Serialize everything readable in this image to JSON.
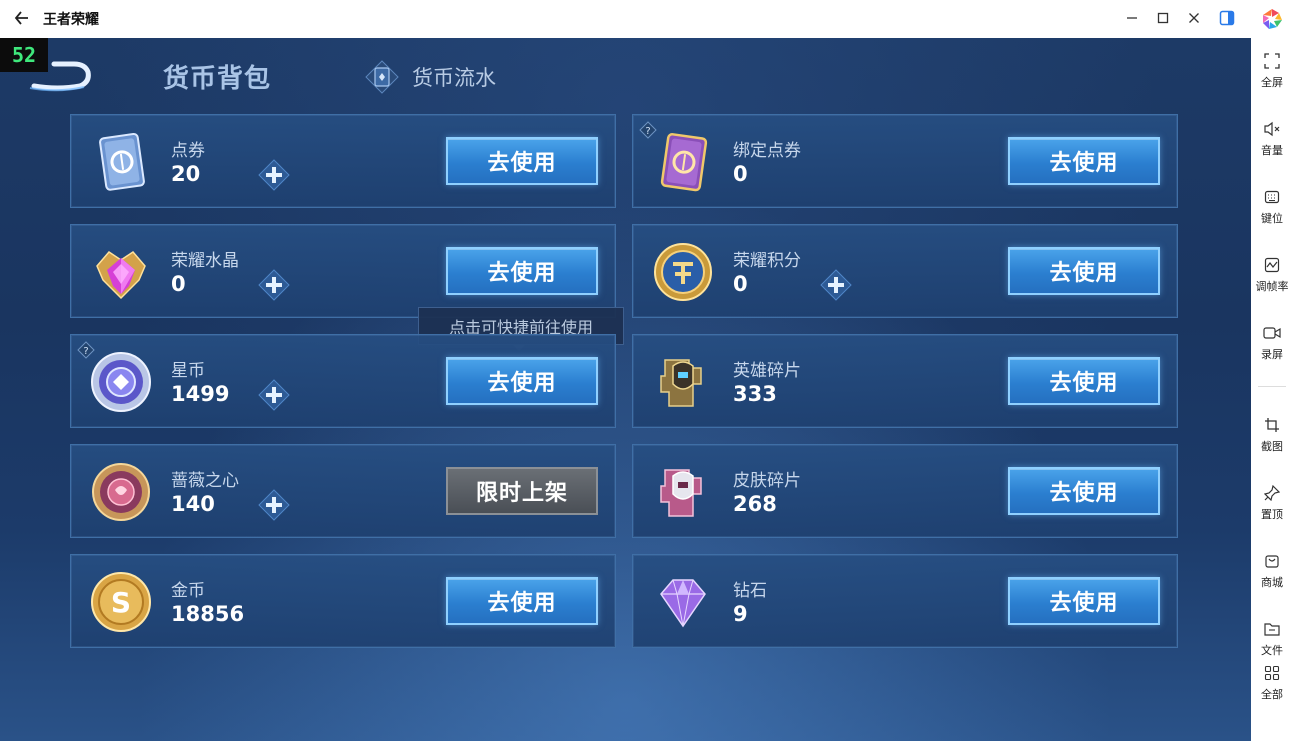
{
  "window": {
    "title": "王者荣耀"
  },
  "fps": "52",
  "tabs": {
    "backpack": "货币背包",
    "flow": "货币流水"
  },
  "tooltip": "点击可快捷前往使用",
  "currencies": [
    {
      "name": "点券",
      "value": "20",
      "button": "去使用"
    },
    {
      "name": "绑定点券",
      "value": "0",
      "button": "去使用"
    },
    {
      "name": "荣耀水晶",
      "value": "0",
      "button": "去使用"
    },
    {
      "name": "荣耀积分",
      "value": "0",
      "button": "去使用"
    },
    {
      "name": "星币",
      "value": "1499",
      "button": "去使用"
    },
    {
      "name": "英雄碎片",
      "value": "333",
      "button": "去使用"
    },
    {
      "name": "蔷薇之心",
      "value": "140",
      "button": "限时上架"
    },
    {
      "name": "皮肤碎片",
      "value": "268",
      "button": "去使用"
    },
    {
      "name": "金币",
      "value": "18856",
      "button": "去使用"
    },
    {
      "name": "钻石",
      "value": "9",
      "button": "去使用"
    }
  ],
  "toolbar": [
    {
      "label": "全屏",
      "icon": "fullscreen-icon"
    },
    {
      "label": "音量",
      "icon": "volume-muted-icon"
    },
    {
      "label": "键位",
      "icon": "keyboard-icon"
    },
    {
      "label": "调帧率",
      "icon": "framerate-icon"
    },
    {
      "label": "录屏",
      "icon": "record-icon"
    },
    {
      "label": "截图",
      "icon": "crop-icon"
    },
    {
      "label": "置顶",
      "icon": "pin-icon"
    },
    {
      "label": "商城",
      "icon": "store-icon"
    },
    {
      "label": "文件",
      "icon": "folder-icon"
    },
    {
      "label": "全部",
      "icon": "grid-icon"
    }
  ],
  "colors": {
    "button_blue": "#2b7fd0",
    "button_gray": "#4a4f56",
    "fps_green": "#3fe87c",
    "panel_bg": "#1a3560",
    "accent_blue": "#2a7ae8"
  }
}
